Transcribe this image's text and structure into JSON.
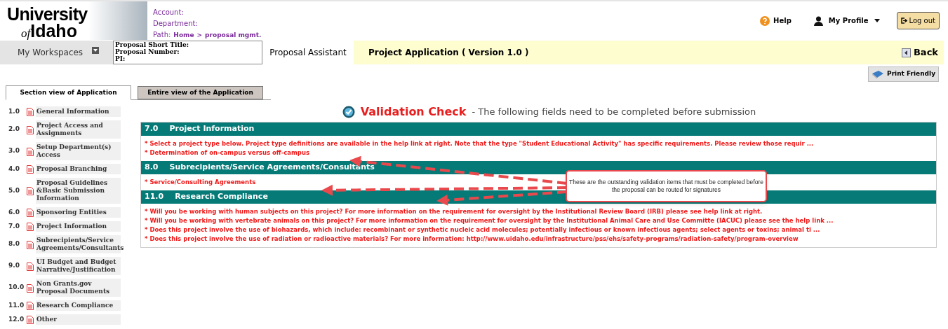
{
  "logo": {
    "line1": "University",
    "of": "of",
    "line2": "Idaho"
  },
  "header": {
    "account_label": "Account:",
    "department_label": "Department:",
    "path_label": "Path:",
    "path": [
      "Home",
      ">",
      "proposal mgmt."
    ],
    "help": "Help",
    "profile": "My Profile",
    "logout": "Log out"
  },
  "nav": {
    "workspaces": "My Workspaces",
    "proposal_fields": [
      "Proposal Short Title:",
      "Proposal Number:",
      "PI:"
    ],
    "assistant": "Proposal Assistant",
    "title": "Project Application ( Version 1.0 )",
    "back": "Back",
    "print": "Print Friendly"
  },
  "tabs": [
    {
      "label": "Section view of Application",
      "selected": true
    },
    {
      "label": "Entire view of the Application",
      "selected": false
    }
  ],
  "sidebar": {
    "items": [
      {
        "number": "1.0",
        "label": "General Information"
      },
      {
        "number": "2.0",
        "label": "Project Access and Assignments"
      },
      {
        "number": "3.0",
        "label": "Setup Department(s) Access"
      },
      {
        "number": "4.0",
        "label": "Proposal Branching"
      },
      {
        "number": "5.0",
        "label": "Proposal Guidelines &Basic Submission Information"
      },
      {
        "number": "6.0",
        "label": "Sponsoring Entities"
      },
      {
        "number": "7.0",
        "label": "Project Information"
      },
      {
        "number": "8.0",
        "label": "Subrecipients/Service Agreements/Consultants"
      },
      {
        "number": "9.0",
        "label": "UI Budget and Budget Narrative/Justification"
      },
      {
        "number": "10.0",
        "label": "Non Grants.gov Proposal Documents"
      },
      {
        "number": "11.0",
        "label": "Research Compliance"
      },
      {
        "number": "12.0",
        "label": "Other"
      }
    ]
  },
  "validation": {
    "title": "Validation Check",
    "subtitle": "- The following fields need to be completed before submission",
    "sections": [
      {
        "number": "7.0",
        "title": "Project Information",
        "items": [
          "* Select a project type below. Project type definitions are available in the help link at right. Note that the type \"Student Educational Activity\" has specific requirements. Please review those requir ...",
          "* Determination of on-campus versus off-campus"
        ]
      },
      {
        "number": "8.0",
        "title": "Subrecipients/Service Agreements/Consultants",
        "items": [
          "* Service/Consulting Agreements"
        ]
      },
      {
        "number": "11.0",
        "title": "Research Compliance",
        "items": [
          "* Will you be working with human subjects on this project? For more information on the requirement for oversight by the Institutional Review Board (IRB) please see help link at right.",
          "* Will you be working with vertebrate animals on this project? For more information on the requirement for oversight by the Institutional Animal Care and Use Committe (IACUC) please see the help link ...",
          "* Does this project involve the use of biohazards, which include: recombinant or synthetic nucleic acid molecules; potentially infectious or known infectious agents; select agents or toxins; animal ti ...",
          "* Does this project involve the use of radiation or radioactive materials? For more information: http://www.uidaho.edu/infrastructure/pss/ehs/safety-programs/radiation-safety/program-overview"
        ]
      }
    ]
  },
  "callout": "These are the outstanding validation items that must be completed before the proposal can be routed for signatures"
}
